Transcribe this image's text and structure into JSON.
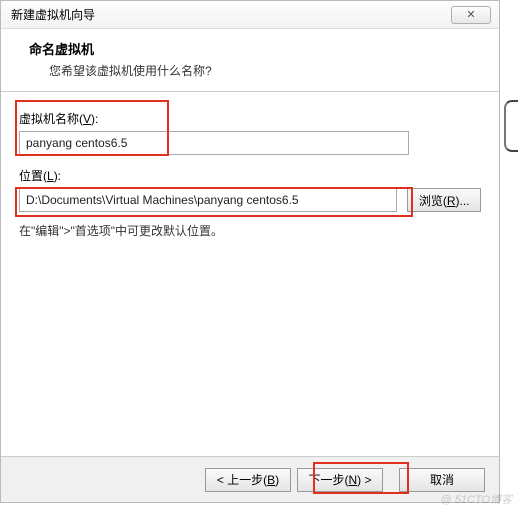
{
  "titlebar": {
    "title": "新建虚拟机向导",
    "close": "✕"
  },
  "header": {
    "title": "命名虚拟机",
    "subtitle": "您希望该虚拟机使用什么名称?"
  },
  "form": {
    "name_label_prefix": "虚拟机名称(",
    "name_label_key": "V",
    "name_label_suffix": "):",
    "name_value": "panyang centos6.5",
    "location_label_prefix": "位置(",
    "location_label_key": "L",
    "location_label_suffix": "):",
    "location_value": "D:\\Documents\\Virtual Machines\\panyang centos6.5",
    "browse_prefix": "浏览(",
    "browse_key": "R",
    "browse_suffix": ")...",
    "hint": "在\"编辑\">\"首选项\"中可更改默认位置。"
  },
  "footer": {
    "back_prefix": "< 上一步(",
    "back_key": "B",
    "back_suffix": ")",
    "next_prefix": "下一步(",
    "next_key": "N",
    "next_suffix": ") >",
    "cancel": "取消"
  },
  "watermark": "@ 51CTO博客"
}
